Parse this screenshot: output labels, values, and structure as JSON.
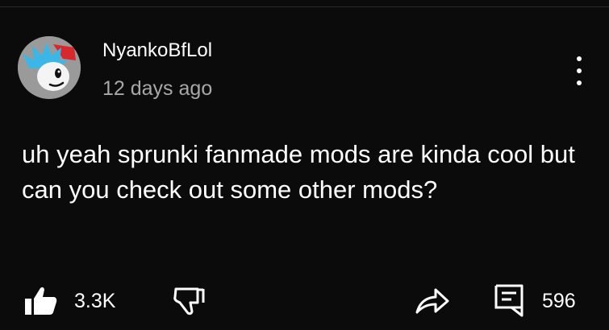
{
  "comment": {
    "author": "NyankoBfLol",
    "timestamp": "12 days ago",
    "text": "uh yeah sprunki fanmade mods are kinda cool but can you check out some other mods?"
  },
  "actions": {
    "like_count": "3.3K",
    "reply_count": "596"
  },
  "icons": {
    "like": "thumbs-up-icon",
    "dislike": "thumbs-down-icon",
    "share": "share-icon",
    "replies": "comment-icon",
    "menu": "more-vert-icon"
  },
  "colors": {
    "background": "#0b0b0b",
    "primary_text": "#ffffff",
    "secondary_text": "#a8a8a8",
    "avatar_bg": "#9a9a9a",
    "avatar_hair": "#3ab7e6",
    "avatar_cap": "#d7282f"
  }
}
